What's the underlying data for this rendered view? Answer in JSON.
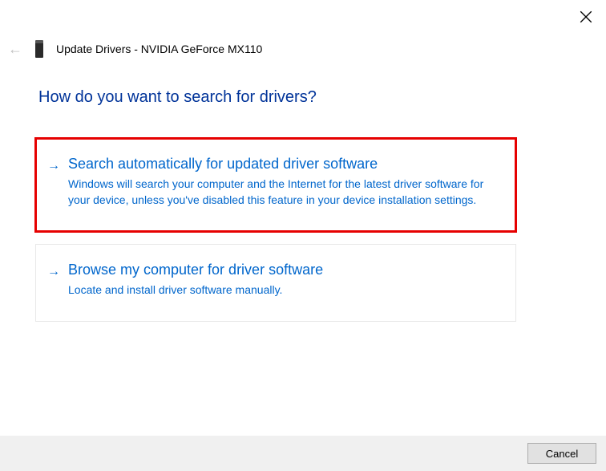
{
  "window": {
    "title": "Update Drivers - NVIDIA GeForce MX110"
  },
  "heading": "How do you want to search for drivers?",
  "options": [
    {
      "title": "Search automatically for updated driver software",
      "description": "Windows will search your computer and the Internet for the latest driver software for your device, unless you've disabled this feature in your device installation settings.",
      "highlighted": true
    },
    {
      "title": "Browse my computer for driver software",
      "description": "Locate and install driver software manually.",
      "highlighted": false
    }
  ],
  "footer": {
    "cancel_label": "Cancel"
  }
}
